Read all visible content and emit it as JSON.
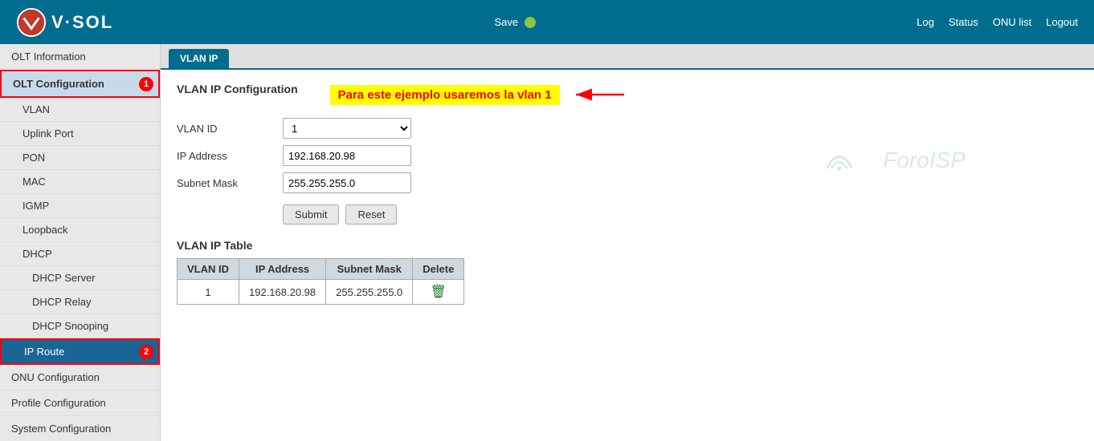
{
  "header": {
    "logo_text": "V·SOL",
    "save_label": "Save",
    "status_color": "#8dc63f",
    "nav_items": [
      "Log",
      "Status",
      "ONU list",
      "Logout"
    ]
  },
  "sidebar": {
    "items": [
      {
        "id": "olt-info",
        "label": "OLT Information",
        "level": 0,
        "active": false
      },
      {
        "id": "olt-config",
        "label": "OLT Configuration",
        "level": 0,
        "active": true,
        "badge": "1"
      },
      {
        "id": "vlan",
        "label": "VLAN",
        "level": 1,
        "active": false
      },
      {
        "id": "uplink-port",
        "label": "Uplink Port",
        "level": 1,
        "active": false
      },
      {
        "id": "pon",
        "label": "PON",
        "level": 1,
        "active": false
      },
      {
        "id": "mac",
        "label": "MAC",
        "level": 1,
        "active": false
      },
      {
        "id": "igmp",
        "label": "IGMP",
        "level": 1,
        "active": false
      },
      {
        "id": "loopback",
        "label": "Loopback",
        "level": 1,
        "active": false
      },
      {
        "id": "dhcp",
        "label": "DHCP",
        "level": 1,
        "active": false
      },
      {
        "id": "dhcp-server",
        "label": "DHCP Server",
        "level": 2,
        "active": false
      },
      {
        "id": "dhcp-relay",
        "label": "DHCP Relay",
        "level": 2,
        "active": false
      },
      {
        "id": "dhcp-snooping",
        "label": "DHCP Snooping",
        "level": 2,
        "active": false
      },
      {
        "id": "ip-route",
        "label": "IP Route",
        "level": 1,
        "active": true,
        "badge": "2"
      },
      {
        "id": "onu-config",
        "label": "ONU Configuration",
        "level": 0,
        "active": false
      },
      {
        "id": "profile-config",
        "label": "Profile Configuration",
        "level": 0,
        "active": false
      },
      {
        "id": "system-config",
        "label": "System Configuration",
        "level": 0,
        "active": false
      }
    ]
  },
  "tab": {
    "label": "VLAN IP"
  },
  "content": {
    "section_title": "VLAN IP Configuration",
    "annotation": "Para este ejemplo usaremos la vlan 1",
    "form": {
      "vlan_id_label": "VLAN ID",
      "vlan_id_value": "1",
      "ip_address_label": "IP Address",
      "ip_address_value": "192.168.20.98",
      "subnet_mask_label": "Subnet Mask",
      "subnet_mask_value": "255.255.255.0",
      "submit_label": "Submit",
      "reset_label": "Reset"
    },
    "table": {
      "title": "VLAN IP Table",
      "columns": [
        "VLAN ID",
        "IP Address",
        "Subnet Mask",
        "Delete"
      ],
      "rows": [
        {
          "vlan_id": "1",
          "ip_address": "192.168.20.98",
          "subnet_mask": "255.255.255.0"
        }
      ]
    }
  },
  "watermark": {
    "text": "ForoISP"
  }
}
